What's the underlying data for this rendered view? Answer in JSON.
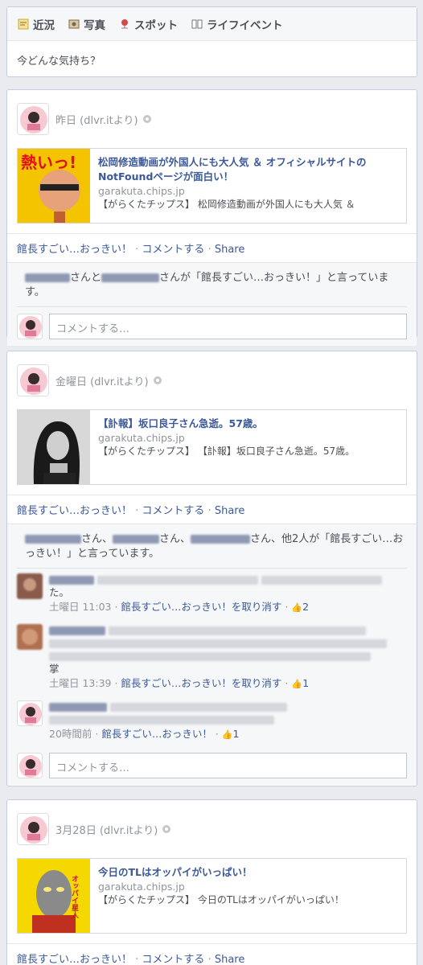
{
  "composer": {
    "tabs": [
      {
        "label": "近況",
        "icon": "status-icon"
      },
      {
        "label": "写真",
        "icon": "photo-icon"
      },
      {
        "label": "スポット",
        "icon": "place-pin-icon"
      },
      {
        "label": "ライフイベント",
        "icon": "life-event-icon"
      }
    ],
    "placeholder": "今どんな気持ち？"
  },
  "stories": [
    {
      "time": "昨日 (dlvr.itより)",
      "link": {
        "title": "松岡修造動画が外国人にも大人気 ＆ オフィシャルサイトのNotFoundページが面白い！",
        "domain": "garakuta.chips.jp",
        "desc": "【がらくたチップス】 松岡修造動画が外国人にも大人気 ＆",
        "thumb_text": "熱いっ!"
      },
      "actions": {
        "like": "館長すごい…おっきい！",
        "comment": "コメントする",
        "share": "Share"
      },
      "likes_text": [
        "さんと",
        "さんが「館長すごい…おっきい！」と言っています。"
      ],
      "comment_placeholder": "コメントする…"
    },
    {
      "time": "金曜日 (dlvr.itより)",
      "link": {
        "title": "【訃報】坂口良子さん急逝。57歳。",
        "domain": "garakuta.chips.jp",
        "desc": "【がらくたチップス】 【訃報】坂口良子さん急逝。57歳。"
      },
      "actions": {
        "like": "館長すごい…おっきい！",
        "comment": "コメントする",
        "share": "Share"
      },
      "likes_text": [
        "さん、",
        "さん、",
        "さん、他2人が「館長すごい…おっきい！」と言っています。"
      ],
      "comments": [
        {
          "tail": "た。",
          "time": "土曜日 11:03",
          "unlike": "館長すごい…おっきい！を取り消す",
          "count": "2"
        },
        {
          "tail": "掌",
          "time": "土曜日 13:39",
          "unlike": "館長すごい…おっきい！を取り消す",
          "count": "1"
        },
        {
          "tail": "",
          "time": "20時間前",
          "unlike": "館長すごい…おっきい！",
          "count": "1"
        }
      ],
      "comment_placeholder": "コメントする…"
    },
    {
      "time": "3月28日 (dlvr.itより)",
      "link": {
        "title": "今日のTLはオッパイがいっぱい！",
        "domain": "garakuta.chips.jp",
        "desc": "【がらくたチップス】 今日のTLはオッパイがいっぱい！",
        "thumb_text": "オッパイ星人"
      },
      "actions": {
        "like": "館長すごい…おっきい！",
        "comment": "コメントする",
        "share": "Share"
      }
    }
  ],
  "colors": {
    "link": "#3b5998",
    "bg": "#e9ebee",
    "border": "#c4cde0"
  }
}
